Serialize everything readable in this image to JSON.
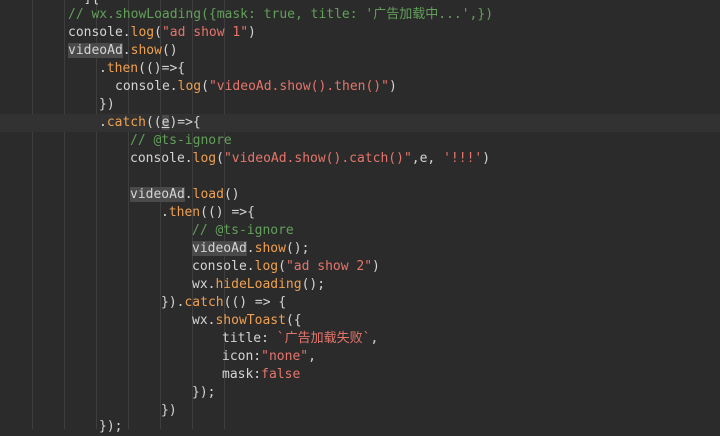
{
  "lines": [
    [
      [
        "pl",
        "  ]{"
      ]
    ],
    [
      [
        "cm",
        "// wx.showLoading({mask: true, title: '广告加载中...',})"
      ]
    ],
    [
      [
        "pl",
        "console."
      ],
      [
        "mt",
        "log"
      ],
      [
        "pl",
        "("
      ],
      [
        "st",
        "\"ad show 1\""
      ],
      [
        "pl",
        ")"
      ]
    ],
    [
      [
        "hl",
        "videoAd"
      ],
      [
        "pl",
        "."
      ],
      [
        "mt",
        "show"
      ],
      [
        "pl",
        "()"
      ]
    ],
    [
      [
        "pl",
        "."
      ],
      [
        "mt",
        "then"
      ],
      [
        "pl",
        "(()=>{"
      ]
    ],
    [
      [
        "pl",
        "console."
      ],
      [
        "mt",
        "log"
      ],
      [
        "pl",
        "("
      ],
      [
        "st",
        "\"videoAd.show().then()\""
      ],
      [
        "pl",
        ")"
      ]
    ],
    [
      [
        "pl",
        "})"
      ]
    ],
    [
      [
        "pl",
        "."
      ],
      [
        "mt",
        "catch"
      ],
      [
        "pl",
        "(("
      ],
      [
        "hlu",
        "e"
      ],
      [
        "pl",
        ")=>{"
      ]
    ],
    [
      [
        "cm",
        "// @ts-ignore"
      ]
    ],
    [
      [
        "pl",
        "console."
      ],
      [
        "mt",
        "log"
      ],
      [
        "pl",
        "("
      ],
      [
        "st",
        "\"videoAd.show().catch()\""
      ],
      [
        "pl",
        ",e, "
      ],
      [
        "st",
        "'!!!'"
      ],
      [
        "pl",
        ")"
      ]
    ],
    [],
    [
      [
        "hl",
        "videoAd"
      ],
      [
        "pl",
        "."
      ],
      [
        "mt",
        "load"
      ],
      [
        "pl",
        "()"
      ]
    ],
    [
      [
        "pl",
        "."
      ],
      [
        "mt",
        "then"
      ],
      [
        "pl",
        "(() =>{"
      ]
    ],
    [
      [
        "cm",
        "// @ts-ignore"
      ]
    ],
    [
      [
        "hl",
        "videoAd"
      ],
      [
        "pl",
        "."
      ],
      [
        "mt",
        "show"
      ],
      [
        "pl",
        "();"
      ]
    ],
    [
      [
        "pl",
        "console."
      ],
      [
        "mt",
        "log"
      ],
      [
        "pl",
        "("
      ],
      [
        "st",
        "\"ad show 2\""
      ],
      [
        "pl",
        ")"
      ]
    ],
    [
      [
        "pl",
        "wx."
      ],
      [
        "mt",
        "hideLoading"
      ],
      [
        "pl",
        "();"
      ]
    ],
    [
      [
        "pl",
        "})."
      ],
      [
        "mt",
        "catch"
      ],
      [
        "pl",
        "(() => {"
      ]
    ],
    [
      [
        "pl",
        "wx."
      ],
      [
        "mt",
        "showToast"
      ],
      [
        "pl",
        "({"
      ]
    ],
    [
      [
        "pl",
        "title: "
      ],
      [
        "st",
        "`广告加载失败`"
      ],
      [
        "pl",
        ","
      ]
    ],
    [
      [
        "pl",
        "icon:"
      ],
      [
        "st",
        "\"none\""
      ],
      [
        "pl",
        ","
      ]
    ],
    [
      [
        "pl",
        "mask:"
      ],
      [
        "st",
        "false"
      ]
    ],
    [
      [
        "pl",
        "});"
      ]
    ],
    [
      [
        "pl",
        "})"
      ]
    ],
    [
      [
        "pl",
        "});"
      ]
    ]
  ]
}
